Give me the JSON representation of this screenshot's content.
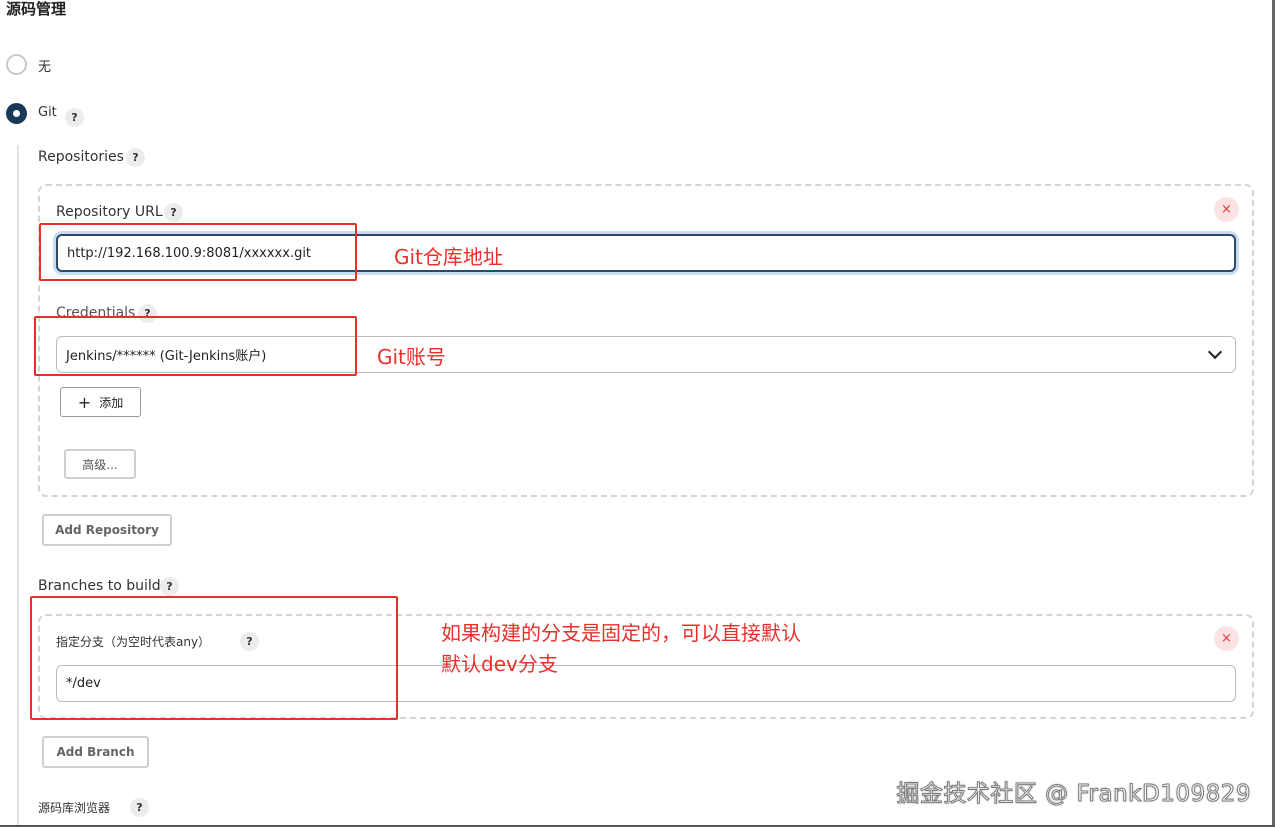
{
  "section": {
    "title": "源码管理"
  },
  "scm": {
    "options": [
      {
        "label": "无",
        "checked": false
      },
      {
        "label": "Git",
        "checked": true
      }
    ]
  },
  "repositories": {
    "label": "Repositories",
    "repo_url_label": "Repository URL",
    "repo_url_value": "http://192.168.100.9:8081/xxxxxx.git",
    "credentials_label": "Credentials",
    "credentials_value": "Jenkins/****** (Git-Jenkins账户)",
    "add_label": "添加",
    "advanced_label": "高级...",
    "add_repository_label": "Add Repository"
  },
  "branches": {
    "label": "Branches to build",
    "specifier_label": "指定分支（为空时代表any）",
    "specifier_value": "*/dev",
    "add_branch_label": "Add Branch"
  },
  "browser": {
    "label": "源码库浏览器"
  },
  "annotations": {
    "repo_note": "Git仓库地址",
    "cred_note": "Git账号",
    "branch_note_line1": "如果构建的分支是固定的，可以直接默认",
    "branch_note_line2": "默认dev分支"
  },
  "watermark": "掘金技术社区 @ FrankD109829",
  "icons": {
    "help": "?",
    "close": "×",
    "plus": "+"
  },
  "colors": {
    "annotation": "#e8302b",
    "radio_checked": "#1a3956",
    "focus_border": "#2b4a68"
  }
}
